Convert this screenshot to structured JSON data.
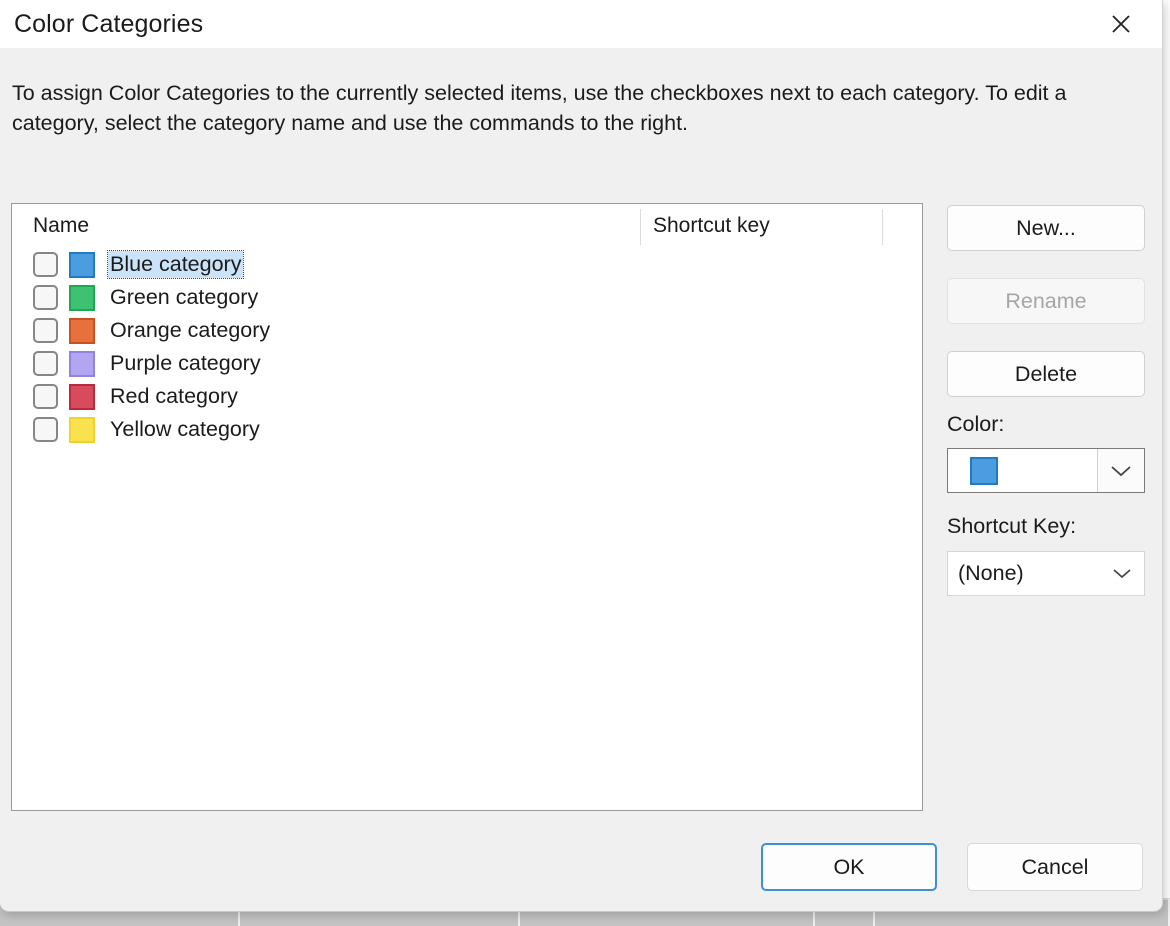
{
  "dialog": {
    "title": "Color Categories",
    "close_icon": "close-icon",
    "instructions": "To assign Color Categories to the currently selected items, use the checkboxes next to each category.  To edit a category, select the category name and use the commands to the right."
  },
  "list": {
    "columns": {
      "name": "Name",
      "shortcut_key": "Shortcut key"
    },
    "rows": [
      {
        "name": "Blue category",
        "color": "#4c9ddf",
        "border": "#1f7cc4",
        "checked": false,
        "selected": true,
        "shortcut": ""
      },
      {
        "name": "Green category",
        "color": "#3fc173",
        "border": "#1fa758",
        "checked": false,
        "selected": false,
        "shortcut": ""
      },
      {
        "name": "Orange category",
        "color": "#e8703c",
        "border": "#c9521f",
        "checked": false,
        "selected": false,
        "shortcut": ""
      },
      {
        "name": "Purple category",
        "color": "#b3a5ef",
        "border": "#9184e0",
        "checked": false,
        "selected": false,
        "shortcut": ""
      },
      {
        "name": "Red category",
        "color": "#d84b5c",
        "border": "#bb2a3c",
        "checked": false,
        "selected": false,
        "shortcut": ""
      },
      {
        "name": "Yellow category",
        "color": "#fae14e",
        "border": "#f2d12c",
        "checked": false,
        "selected": false,
        "shortcut": ""
      }
    ]
  },
  "side_panel": {
    "new_label": "New...",
    "rename_label": "Rename",
    "delete_label": "Delete",
    "color_label": "Color:",
    "color_value": "#4c9ddf",
    "color_value_border": "#1f7cc4",
    "shortcut_label": "Shortcut Key:",
    "shortcut_value": "(None)",
    "dropdown_icon": "chevron-down-icon"
  },
  "footer": {
    "ok_label": "OK",
    "cancel_label": "Cancel"
  },
  "theme": {
    "accent": "#3f8fd4",
    "dialog_background": "#f0f0f0",
    "selection_highlight": "#cbe3f8",
    "text": "#1b1b1b"
  }
}
